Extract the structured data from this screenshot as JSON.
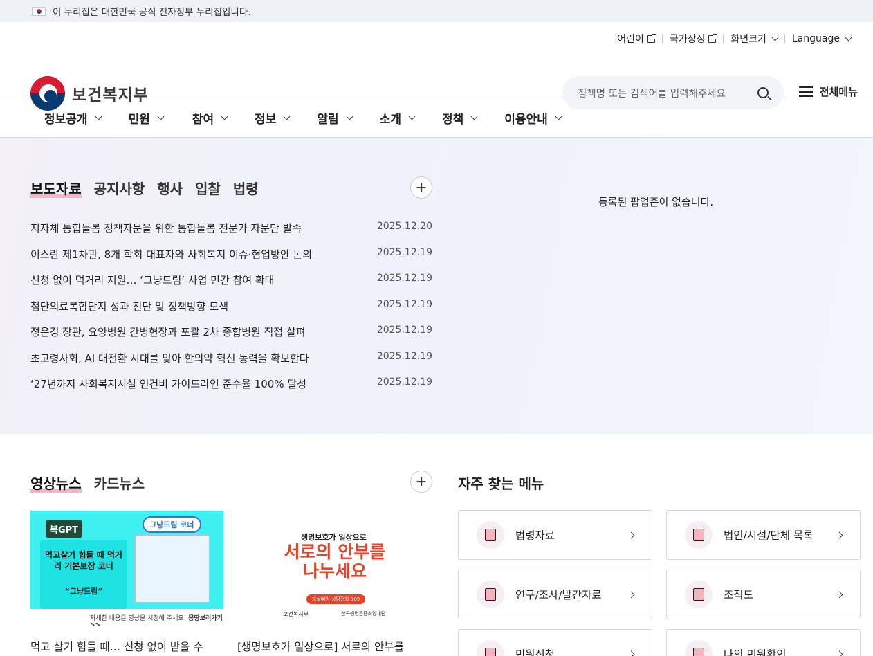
{
  "gov_banner": {
    "text": "이 누리집은 대한민국 공식 전자정부 누리집입니다."
  },
  "utility": {
    "kids": "어린이",
    "symbols": "국가상징",
    "font_size": "화면크기",
    "language": "Language"
  },
  "logo": {
    "text": "보건복지부"
  },
  "search": {
    "placeholder": "정책명 또는 검색어를 입력해주세요"
  },
  "all_menu": "전체메뉴",
  "gnb": [
    "정보공개",
    "민원",
    "참여",
    "정보",
    "알림",
    "소개",
    "정책",
    "이용안내"
  ],
  "news_tabs": [
    "보도자료",
    "공지사항",
    "행사",
    "입찰",
    "법령"
  ],
  "news": [
    {
      "title": "지자체 통합돌봄 정책자문을 위한 통합돌봄 전문가 자문단 발족",
      "date": "2025.12.20"
    },
    {
      "title": "이스란 제1차관, 8개 학회 대표자와 사회복지 이슈·협업방안 논의",
      "date": "2025.12.19"
    },
    {
      "title": "신청 없이 먹거리 지원… ‘그냥드림’ 사업 민간 참여 확대",
      "date": "2025.12.19"
    },
    {
      "title": "첨단의료복합단지 성과 진단 및 정책방향 모색",
      "date": "2025.12.19"
    },
    {
      "title": "정은경 장관, 요양병원 간병현장과 포괄 2차 종합병원 직접 살펴",
      "date": "2025.12.19"
    },
    {
      "title": "초고령사회, AI 대전환 시대를 맞아 한의약 혁신 동력을 확보한다",
      "date": "2025.12.19"
    },
    {
      "title": "‘27년까지 사회복지시설 인건비 가이드라인 준수율 100% 달성",
      "date": "2025.12.19"
    }
  ],
  "popup_empty": "등록된 팝업존이 없습니다.",
  "media_tabs": [
    "영상뉴스",
    "카드뉴스"
  ],
  "videos": [
    {
      "caption": "먹고 살기 힘들 때… 신청 없이 받을 수",
      "badge": "복GPT",
      "headline": "먹고살기 힘들 때 먹거리 기본보장 코너",
      "sub": "“그냥드림”",
      "tag": "그냥드림 코너",
      "footer": "자세한 내용은 영상을 시청해 주세요!",
      "more": "몽땅보러가기 >>"
    },
    {
      "caption": "[생명보호가 일상으로] 서로의 안부를",
      "top": "생명보호가 일상으로",
      "headline": "서로의 안부를 나누세요",
      "pill": "자살예방 상담전화 109",
      "org1": "보건복지부",
      "org2": "한국생명존중희망재단"
    }
  ],
  "fav_title": "자주 찾는 메뉴",
  "fav": [
    "법령자료",
    "법인/시설/단체 목록",
    "연구/조사/발간자료",
    "조직도",
    "민원신청",
    "나의 민원확인"
  ]
}
